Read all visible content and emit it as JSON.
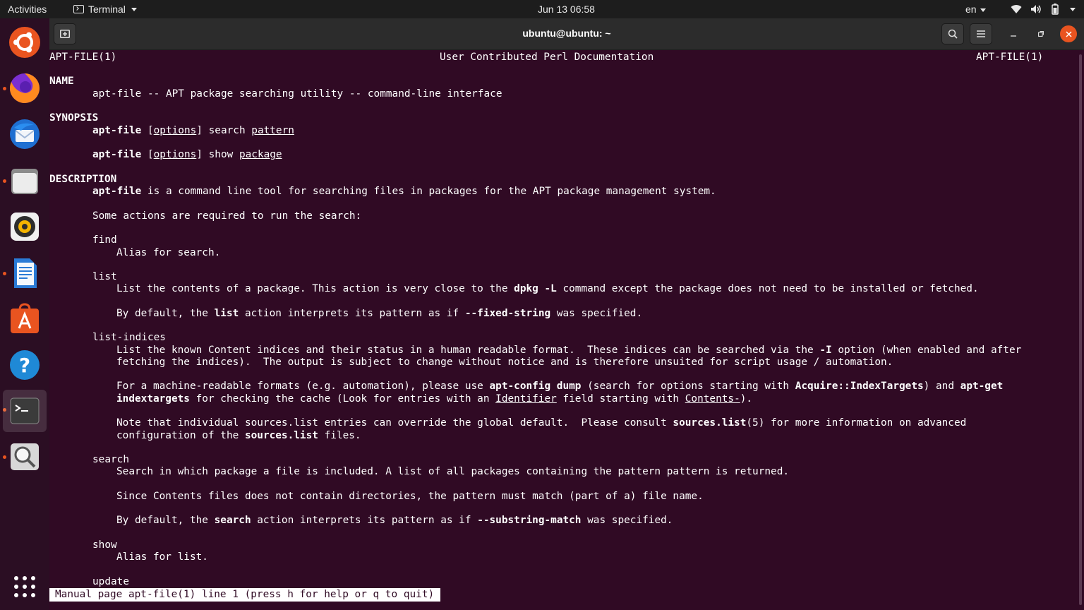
{
  "topbar": {
    "activities": "Activities",
    "app_menu": "Terminal",
    "clock": "Jun 13  06:58",
    "lang": "en"
  },
  "dock": {
    "items": [
      {
        "name": "ubuntu-logo",
        "running": false
      },
      {
        "name": "firefox",
        "running": true
      },
      {
        "name": "thunderbird",
        "running": false
      },
      {
        "name": "files",
        "running": true
      },
      {
        "name": "rhythmbox",
        "running": false
      },
      {
        "name": "libreoffice-writer",
        "running": true
      },
      {
        "name": "ubuntu-software",
        "running": false
      },
      {
        "name": "help",
        "running": false
      },
      {
        "name": "terminal",
        "running": true,
        "active": true
      },
      {
        "name": "screenshot-search",
        "running": true
      },
      {
        "name": "show-applications",
        "running": false
      }
    ]
  },
  "window": {
    "title": "ubuntu@ubuntu: ~"
  },
  "man": {
    "header_left": "APT-FILE(1)",
    "header_center": "User Contributed Perl Documentation",
    "header_right": "APT-FILE(1)",
    "name_heading": "NAME",
    "name_text": "apt-file -- APT package searching utility -- command-line interface",
    "synopsis_heading": "SYNOPSIS",
    "synopsis_cmd": "apt-file",
    "synopsis_options": "options",
    "synopsis_search": "search",
    "synopsis_pattern": "pattern",
    "synopsis_show": "show",
    "synopsis_package": "package",
    "description_heading": "DESCRIPTION",
    "desc_cmd": "apt-file",
    "desc_text": " is a command line tool for searching files in packages for the APT package management system.",
    "desc_actions": "Some actions are required to run the search:",
    "find_term": "find",
    "find_desc": "Alias for search.",
    "list_term": "list",
    "list_desc_pre": "List the contents of a package. This action is very close to the ",
    "list_desc_cmd": "dpkg -L",
    "list_desc_post": " command except the package does not need to be installed or fetched.",
    "list_default_pre": "By default, the ",
    "list_default_kw": "list",
    "list_default_mid": " action interprets its pattern as if ",
    "list_default_opt": "--fixed-string",
    "list_default_post": " was specified.",
    "li_term": "list-indices",
    "li_1_pre": "List the known Content indices and their status in a human readable format.  These indices can be searched via the ",
    "li_1_opt": "-I",
    "li_1_post": " option (when enabled and after",
    "li_2": "fetching the indices).  The output is subject to change without notice and is therefore unsuited for script usage / automation.",
    "li_3_pre": "For a machine-readable formats (e.g. automation), please use ",
    "li_3_cmd": "apt-config dump",
    "li_3_mid": " (search for options starting with ",
    "li_3_acq": "Acquire::IndexTargets",
    "li_3_and": ") and ",
    "li_3_aptget": "apt-get",
    "li_4_cmd": "indextargets",
    "li_4_mid": " for checking the cache (Look for entries with an ",
    "li_4_ident": "Identifier",
    "li_4_mid2": " field starting with ",
    "li_4_contents": "Contents-",
    "li_4_end": ").",
    "li_5_pre": "Note that individual sources.list entries can override the global default.  Please consult ",
    "li_5_kw": "sources.list",
    "li_5_post": "(5) for more information on advanced",
    "li_6_pre": "configuration of the ",
    "li_6_kw": "sources.list",
    "li_6_post": " files.",
    "search_term": "search",
    "search_desc": "Search in which package a file is included. A list of all packages containing the pattern pattern is returned.",
    "search_contents": "Since Contents files does not contain directories, the pattern must match (part of a) file name.",
    "search_default_pre": "By default, the ",
    "search_default_kw": "search",
    "search_default_mid": " action interprets its pattern as if ",
    "search_default_opt": "--substring-match",
    "search_default_post": " was specified.",
    "show_term": "show",
    "show_desc": "Alias for list.",
    "update_term": "update",
    "status_line": "Manual page apt-file(1) line 1 (press h for help or q to quit)"
  }
}
